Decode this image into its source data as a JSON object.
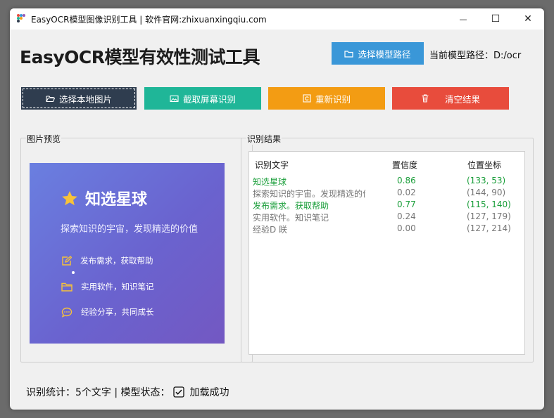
{
  "window": {
    "title": "EasyOCR模型图像识别工具 | 软件官网:zhixuanxingqiu.com",
    "controls": {
      "minimize": "—",
      "maximize": "☐",
      "close": "✕"
    }
  },
  "header": {
    "app_title": "EasyOCR模型有效性测试工具",
    "select_model_label": "选择模型路径",
    "model_path_text": "当前模型路径：D:/ocr"
  },
  "toolbar": {
    "select_local_label": "选择本地图片",
    "screenshot_label": "截取屏幕识别",
    "rerun_label": "重新识别",
    "clear_label": "清空结果"
  },
  "preview": {
    "group_label": "图片预览",
    "title": "知选星球",
    "subtitle": "探索知识的宇宙，发现精选的价值",
    "items": [
      {
        "icon": "edit-icon",
        "text": "发布需求，获取帮助"
      },
      {
        "icon": "folder-icon",
        "text": "实用软件，知识笔记"
      },
      {
        "icon": "chat-icon",
        "text": "经验分享，共同成长"
      }
    ]
  },
  "results": {
    "group_label": "识别结果",
    "headers": {
      "text": "识别文字",
      "confidence": "置信度",
      "position": "位置坐标"
    },
    "rows": [
      {
        "text": "知选星球",
        "confidence": "0.86",
        "position": "(133, 53)",
        "color": "#1a9e3a"
      },
      {
        "text": "探索知识的宇宙。发现精选的价",
        "confidence": "0.02",
        "position": "(144, 90)",
        "color": "#777777"
      },
      {
        "text": "发布需求。获取帮助",
        "confidence": "0.77",
        "position": "(115, 140)",
        "color": "#1a9e3a"
      },
      {
        "text": "实用软件。知识笔记",
        "confidence": "0.24",
        "position": "(127, 179)",
        "color": "#777777"
      },
      {
        "text": "经验D 眹",
        "confidence": "0.00",
        "position": "(127, 214)",
        "color": "#777777"
      }
    ]
  },
  "status": {
    "text": "识别统计：5个文字 | 模型状态：",
    "loaded_text": "加载成功"
  },
  "colors": {
    "model_button": "#3a97d8",
    "local_button": "#2f3d4f",
    "screen_button": "#1fb698",
    "rerun_button": "#f39c13",
    "clear_button": "#e84c3c",
    "high_confidence": "#1a9e3a",
    "low_confidence": "#777777"
  }
}
